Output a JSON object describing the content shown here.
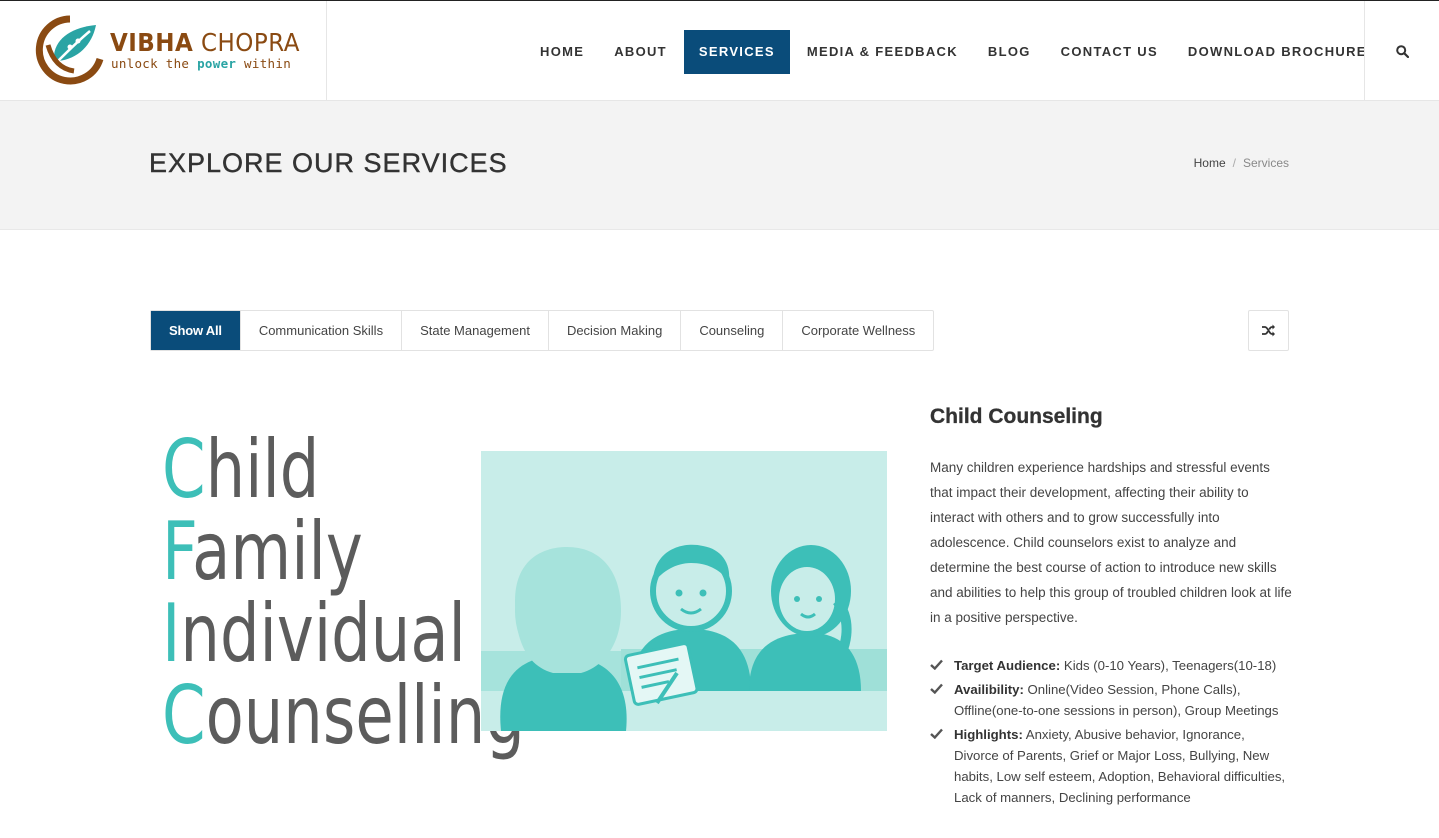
{
  "brand": {
    "name_bold": "VIBHA",
    "name_light": "CHOPRA",
    "tagline_pre": "unlock the ",
    "tagline_hl": "power",
    "tagline_post": " within"
  },
  "nav": {
    "items": [
      {
        "label": "HOME"
      },
      {
        "label": "ABOUT"
      },
      {
        "label": "SERVICES"
      },
      {
        "label": "MEDIA & FEEDBACK"
      },
      {
        "label": "BLOG"
      },
      {
        "label": "CONTACT US"
      },
      {
        "label": "DOWNLOAD BROCHURE"
      }
    ],
    "active": "SERVICES",
    "search_icon": "search-icon"
  },
  "title_bar": {
    "title": "EXPLORE OUR SERVICES",
    "breadcrumb": {
      "home": "Home",
      "separator": "/",
      "current": "Services"
    }
  },
  "filters": {
    "items": [
      {
        "label": "Show All"
      },
      {
        "label": "Communication Skills"
      },
      {
        "label": "State Management"
      },
      {
        "label": "Decision Making"
      },
      {
        "label": "Counseling"
      },
      {
        "label": "Corporate Wellness"
      }
    ],
    "active": "Show All",
    "shuffle_icon": "shuffle-icon"
  },
  "illustration": {
    "words": [
      {
        "first": "C",
        "rest": "hild"
      },
      {
        "first": "F",
        "rest": "amily"
      },
      {
        "first": "I",
        "rest": "ndividual"
      },
      {
        "first": "C",
        "rest": "ounselling"
      }
    ]
  },
  "service": {
    "title": "Child Counseling",
    "description": "Many children experience hardships and stressful events that impact their development, affecting their ability to interact with others and to grow successfully into adolescence. Child counselors exist to analyze and determine the best course of action to introduce new skills and abilities to help this group of troubled children look at life in a positive perspective.",
    "details": [
      {
        "label": "Target Audience:",
        "text": " Kids (0-10 Years), Teenagers(10-18)"
      },
      {
        "label": "Availibility:",
        "text": " Online(Video Session, Phone Calls), Offline(one-to-one sessions in person), Group Meetings"
      },
      {
        "label": "Highlights:",
        "text": " Anxiety, Abusive behavior, Ignorance, Divorce of Parents, Grief or Major Loss, Bullying, New habits, Low self esteem, Adoption, Behavioral difficulties, Lack of manners, Declining performance"
      }
    ]
  },
  "colors": {
    "primary": "#0a4c7a",
    "brand_brown": "#8a4a12",
    "teal": "#3dbfb8",
    "title_bar_bg": "#f3f3f3"
  }
}
